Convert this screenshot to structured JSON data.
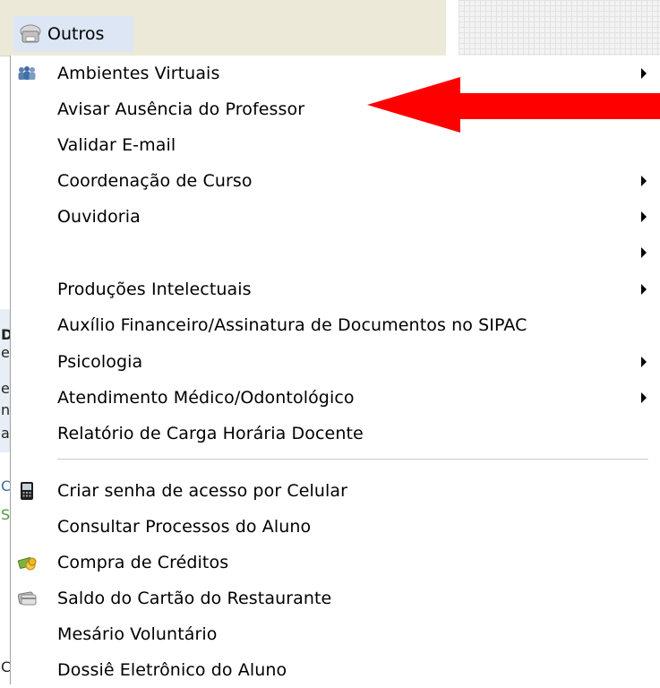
{
  "menubar": {
    "title": "Outros",
    "icon": "printer-icon"
  },
  "background_fragments": [
    "D",
    "e",
    "e",
    "n",
    "a",
    "C",
    "S",
    "C"
  ],
  "menu": {
    "items": [
      {
        "label": "Ambientes Virtuais",
        "icon": "people-icon",
        "submenu": true
      },
      {
        "label": "Avisar Ausência do Professor",
        "icon": "",
        "submenu": false
      },
      {
        "label": "Validar E-mail",
        "icon": "",
        "submenu": false
      },
      {
        "label": "Coordenação de Curso",
        "icon": "",
        "submenu": true
      },
      {
        "label": "Ouvidoria",
        "icon": "",
        "submenu": true
      },
      {
        "label": "",
        "icon": "",
        "submenu": true
      },
      {
        "label": "Produções Intelectuais",
        "icon": "",
        "submenu": true
      },
      {
        "label": "Auxílio Financeiro/Assinatura de Documentos no SIPAC",
        "icon": "",
        "submenu": false
      },
      {
        "label": "Psicologia",
        "icon": "",
        "submenu": true
      },
      {
        "label": "Atendimento Médico/Odontológico",
        "icon": "",
        "submenu": true
      },
      {
        "label": "Relatório de Carga Horária Docente",
        "icon": "",
        "submenu": false
      },
      {
        "label": "Criar senha de acesso por Celular",
        "icon": "mobile-phone-icon",
        "submenu": false
      },
      {
        "label": "Consultar Processos do Aluno",
        "icon": "",
        "submenu": false
      },
      {
        "label": "Compra de Créditos",
        "icon": "money-icon",
        "submenu": false
      },
      {
        "label": "Saldo do Cartão do Restaurante",
        "icon": "card-icon",
        "submenu": false
      },
      {
        "label": "Mesário Voluntário",
        "icon": "",
        "submenu": false
      },
      {
        "label": "Dossiê Eletrônico do Aluno",
        "icon": "",
        "submenu": false
      }
    ]
  },
  "annotation": {
    "type": "red-arrow",
    "color": "#ff0000",
    "points_to": "Avisar Ausência do Professor"
  }
}
